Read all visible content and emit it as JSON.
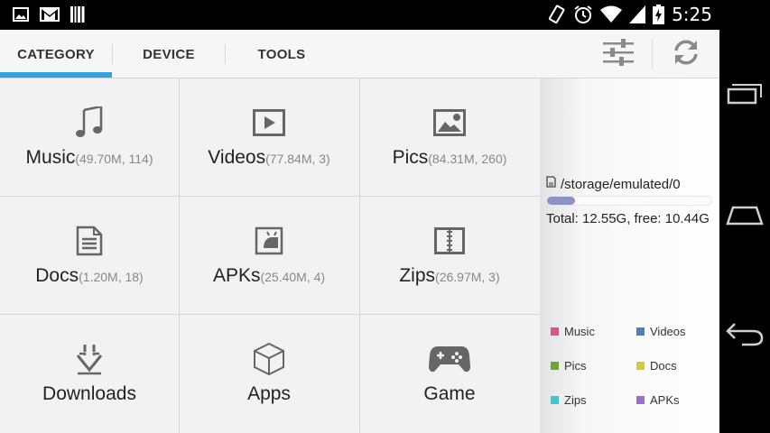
{
  "status_bar": {
    "time": "5:25",
    "left_icons": [
      "image-icon",
      "gmail-icon",
      "barcode-icon"
    ],
    "right_icons": [
      "vibrate-icon",
      "alarm-icon",
      "wifi-icon",
      "signal-icon",
      "battery-icon"
    ]
  },
  "tabs": [
    {
      "label": "CATEGORY",
      "active": true
    },
    {
      "label": "DEVICE",
      "active": false
    },
    {
      "label": "TOOLS",
      "active": false
    }
  ],
  "toolbar": {
    "buttons": [
      "sliders-icon",
      "refresh-icon"
    ]
  },
  "categories": [
    {
      "name": "Music",
      "meta": "(49.70M, 114)",
      "icon": "music-note-icon"
    },
    {
      "name": "Videos",
      "meta": "(77.84M, 3)",
      "icon": "video-play-icon"
    },
    {
      "name": "Pics",
      "meta": "(84.31M, 260)",
      "icon": "picture-icon"
    },
    {
      "name": "Docs",
      "meta": "(1.20M, 18)",
      "icon": "document-icon"
    },
    {
      "name": "APKs",
      "meta": "(25.40M, 4)",
      "icon": "apk-icon"
    },
    {
      "name": "Zips",
      "meta": "(26.97M, 3)",
      "icon": "zip-icon"
    },
    {
      "name": "Downloads",
      "meta": "",
      "icon": "download-icon"
    },
    {
      "name": "Apps",
      "meta": "",
      "icon": "cube-icon"
    },
    {
      "name": "Game",
      "meta": "",
      "icon": "gamepad-icon"
    }
  ],
  "storage": {
    "path": "/storage/emulated/0",
    "used_fraction": 0.168,
    "total_text": "Total: 12.55G, free: 10.44G"
  },
  "legend": [
    {
      "label": "Music",
      "color": "#d05a8a"
    },
    {
      "label": "Videos",
      "color": "#4a7fc4"
    },
    {
      "label": "Pics",
      "color": "#6aa63a"
    },
    {
      "label": "Docs",
      "color": "#d8c93a"
    },
    {
      "label": "Zips",
      "color": "#46c4cc"
    },
    {
      "label": "APKs",
      "color": "#9a6fd0"
    }
  ],
  "colors": {
    "accent": "#33a3de",
    "storage_bar": "#8a93c2"
  },
  "nav_bar": [
    "recent-apps-icon",
    "home-icon",
    "back-icon"
  ]
}
